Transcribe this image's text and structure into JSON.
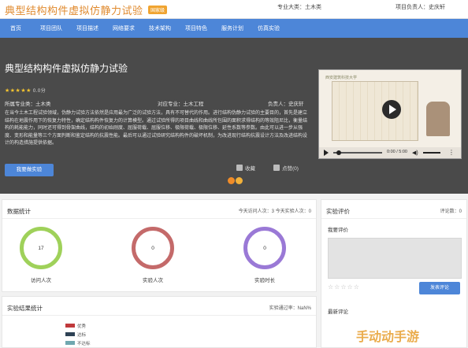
{
  "header": {
    "title": "典型结构构件虚拟仿静力试验",
    "badge": "国家级",
    "major": "专业大类：土木类",
    "lead": "项目负责人：史庆轩"
  },
  "nav": {
    "items": [
      {
        "label": "首页"
      },
      {
        "label": "项目团队"
      },
      {
        "label": "项目描述"
      },
      {
        "label": "网络要求"
      },
      {
        "label": "技术架构"
      },
      {
        "label": "项目特色"
      },
      {
        "label": "服务计划"
      },
      {
        "label": "仿真实验"
      }
    ]
  },
  "hero": {
    "title": "典型结构构件虚拟仿静力试验",
    "stars": "★★★★★",
    "score": "0.0分",
    "school_major": "所属专业类：土木类",
    "target_major": "对应专业：土木工程",
    "lead": "负责人：史庆轩",
    "description": "在当今土木工程试验领域，伪静力试验方法依然是应用最为广泛的试验方法，具有不可替代的作用。进行结构伪静力试验的主要目的，首先是建立结构在地震作用下的恢复力特性，确定结构构件恢复力的计算模型。通过试验所得的项目曲线和曲线所包围的面积求得结构的等效阻尼比，衡量结构的耗能能力，同时还可得到骨架曲线，结构的初始刚度、屈服荷载、屈服位移、极限荷载、极限位移、延性系数等参数。由此可以进一步从强度、变形和能量等三个方面判断和鉴定结构的抗震性能。最后可以通过试验研究结构构件的破坏机制，为改进现行结构抗震设计方法及改进结构设计的构造措施提供依据。",
    "button": "我要做实验",
    "fav": "收藏",
    "like": "点赞(0)"
  },
  "video": {
    "caption": "西安建筑科技大学",
    "time": "0:00 / 5:00"
  },
  "stats": {
    "title": "数据统计",
    "summary": "今天访问人次：3 今天实验人次：0",
    "rings": [
      {
        "value": "17",
        "label": "访问人次",
        "color": "#9fd15a"
      },
      {
        "value": "0",
        "label": "实验人次",
        "color": "#c46a6a"
      },
      {
        "value": "0",
        "label": "实验时长",
        "color": "#9a79d6"
      }
    ]
  },
  "results": {
    "title": "实验结果统计",
    "pass_rate": "实验通过率：NaN%",
    "legend": [
      {
        "label": "优秀",
        "color": "#c0393b"
      },
      {
        "label": "达标",
        "color": "#2e4255"
      },
      {
        "label": "不达标",
        "color": "#6fa8b0"
      }
    ]
  },
  "comments": {
    "title": "实验评价",
    "count": "评论数：0",
    "my_label": "我要评价",
    "stars": "☆☆☆☆☆",
    "submit": "发表评论",
    "latest": "最新评论"
  },
  "watermark": "手动动手游"
}
